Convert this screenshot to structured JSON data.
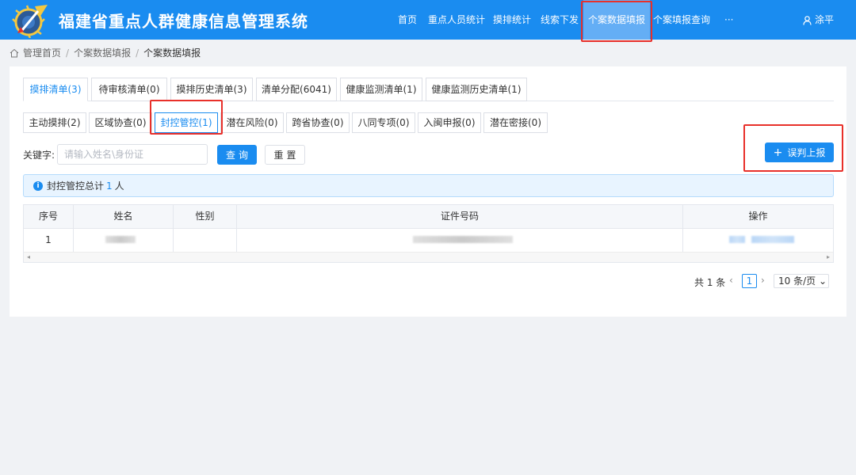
{
  "header": {
    "app_title": "福建省重点人群健康信息管理系统",
    "nav": [
      "首页",
      "重点人员统计",
      "摸排统计",
      "线索下发",
      "个案数据填报",
      "个案填报查询",
      "···"
    ],
    "active_nav": "个案数据填报",
    "user": "涂平",
    "bg_color": "#1a8cf0"
  },
  "breadcrumb": {
    "home": "管理首页",
    "level1": "个案数据填报",
    "current": "个案数据填报"
  },
  "tabs_primary": [
    "摸排清单(3)",
    "待审核清单(0)",
    "摸排历史清单(3)",
    "清单分配(6041)",
    "健康监测清单(1)",
    "健康监测历史清单(1)"
  ],
  "tabs_secondary": [
    "主动摸排(2)",
    "区域协查(0)",
    "封控管控(1)",
    "潜在风险(0)",
    "跨省协查(0)",
    "八同专项(0)",
    "入闽申报(0)",
    "潜在密接(0)"
  ],
  "search": {
    "label": "关键字:",
    "placeholder": "请输入姓名\\身份证",
    "query_btn": "查询",
    "reset_btn": "重置"
  },
  "report_btn": "误判上报",
  "alert": {
    "prefix": "封控管控总计",
    "count": "1",
    "suffix": "人"
  },
  "table": {
    "columns": [
      "序号",
      "姓名",
      "性别",
      "证件号码",
      "操作"
    ],
    "rows": [
      {
        "index": "1"
      }
    ]
  },
  "pagination": {
    "total": "共 1 条",
    "current_page": "1",
    "page_size": "10 条/页"
  },
  "colors": {
    "primary": "#1a8cf0",
    "highlight": "#e8302a"
  }
}
